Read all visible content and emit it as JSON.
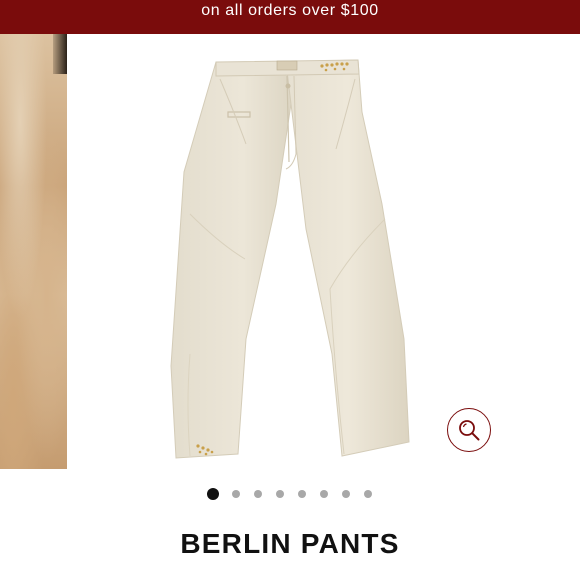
{
  "promo": {
    "text": "on all orders over $100"
  },
  "gallery": {
    "slide_count": 8,
    "active_index": 0
  },
  "icons": {
    "zoom": "magnifier-icon"
  },
  "product": {
    "title": "BERLIN PANTS"
  },
  "colors": {
    "brand": "#7a0c0c",
    "dot_active": "#111111",
    "dot_inactive": "#a8a8a8"
  }
}
